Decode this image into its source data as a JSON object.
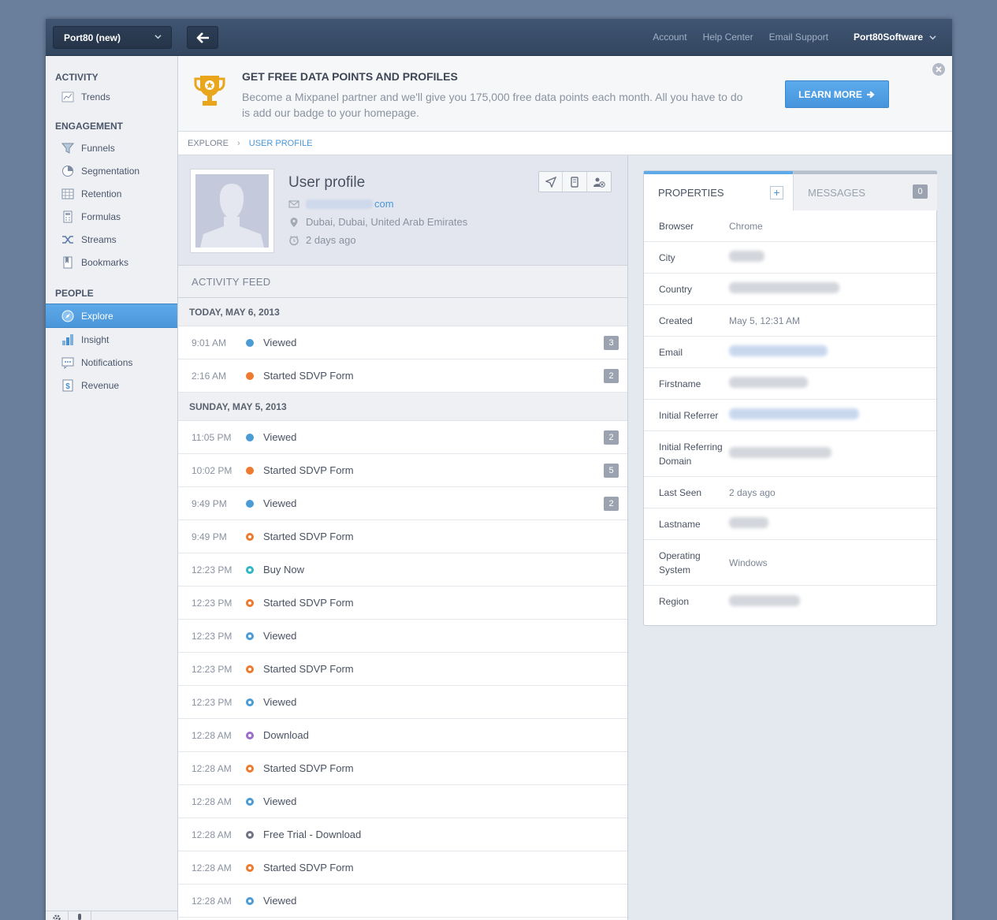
{
  "topbar": {
    "project": "Port80 (new)",
    "links": [
      "Account",
      "Help Center",
      "Email Support"
    ],
    "user": "Port80Software"
  },
  "sidebar": {
    "sections": [
      {
        "title": "ACTIVITY",
        "items": [
          {
            "label": "Trends",
            "icon": "trends-icon"
          }
        ]
      },
      {
        "title": "ENGAGEMENT",
        "items": [
          {
            "label": "Funnels",
            "icon": "funnel-icon"
          },
          {
            "label": "Segmentation",
            "icon": "pie-chart-icon"
          },
          {
            "label": "Retention",
            "icon": "retention-grid-icon"
          },
          {
            "label": "Formulas",
            "icon": "calculator-icon"
          },
          {
            "label": "Streams",
            "icon": "shuffle-icon"
          },
          {
            "label": "Bookmarks",
            "icon": "bookmark-icon"
          }
        ]
      },
      {
        "title": "PEOPLE",
        "items": [
          {
            "label": "Explore",
            "icon": "compass-icon",
            "active": true
          },
          {
            "label": "Insight",
            "icon": "bar-chart-icon"
          },
          {
            "label": "Notifications",
            "icon": "message-icon"
          },
          {
            "label": "Revenue",
            "icon": "dollar-icon"
          }
        ]
      }
    ]
  },
  "banner": {
    "title": "GET FREE DATA POINTS AND PROFILES",
    "text": "Become a Mixpanel partner and we'll give you 175,000 free data points each month. All you have to do is add our badge to your homepage.",
    "button": "LEARN MORE"
  },
  "breadcrumb": {
    "parent": "EXPLORE",
    "current": "USER PROFILE"
  },
  "profile": {
    "title": "User profile",
    "email_suffix": "com",
    "location": "Dubai, Dubai, United Arab Emirates",
    "last_seen": "2 days ago"
  },
  "feed": {
    "header": "ACTIVITY FEED",
    "days": [
      {
        "label": "TODAY, MAY 6, 2013",
        "events": [
          {
            "time": "9:01 AM",
            "name": "Viewed",
            "color": "#4b9bd6",
            "ring": false,
            "count": "3"
          },
          {
            "time": "2:16 AM",
            "name": "Started SDVP Form",
            "color": "#ee7a30",
            "ring": false,
            "count": "2"
          }
        ]
      },
      {
        "label": "SUNDAY, MAY 5, 2013",
        "events": [
          {
            "time": "11:05 PM",
            "name": "Viewed",
            "color": "#4b9bd6",
            "ring": false,
            "count": "2"
          },
          {
            "time": "10:02 PM",
            "name": "Started SDVP Form",
            "color": "#ee7a30",
            "ring": false,
            "count": "5"
          },
          {
            "time": "9:49 PM",
            "name": "Viewed",
            "color": "#4b9bd6",
            "ring": false,
            "count": "2"
          },
          {
            "time": "9:49 PM",
            "name": "Started SDVP Form",
            "color": "#ee7a30",
            "ring": true,
            "count": ""
          },
          {
            "time": "12:23 PM",
            "name": "Buy Now",
            "color": "#2fb8c4",
            "ring": true,
            "count": ""
          },
          {
            "time": "12:23 PM",
            "name": "Started SDVP Form",
            "color": "#ee7a30",
            "ring": true,
            "count": ""
          },
          {
            "time": "12:23 PM",
            "name": "Viewed",
            "color": "#4b9bd6",
            "ring": true,
            "count": ""
          },
          {
            "time": "12:23 PM",
            "name": "Started SDVP Form",
            "color": "#ee7a30",
            "ring": true,
            "count": ""
          },
          {
            "time": "12:23 PM",
            "name": "Viewed",
            "color": "#4b9bd6",
            "ring": true,
            "count": ""
          },
          {
            "time": "12:28 AM",
            "name": "Download",
            "color": "#9b6fc9",
            "ring": true,
            "count": ""
          },
          {
            "time": "12:28 AM",
            "name": "Started SDVP Form",
            "color": "#ee7a30",
            "ring": true,
            "count": ""
          },
          {
            "time": "12:28 AM",
            "name": "Viewed",
            "color": "#4b9bd6",
            "ring": true,
            "count": ""
          },
          {
            "time": "12:28 AM",
            "name": "Free Trial - Download",
            "color": "#6f7382",
            "ring": true,
            "count": ""
          },
          {
            "time": "12:28 AM",
            "name": "Started SDVP Form",
            "color": "#ee7a30",
            "ring": true,
            "count": ""
          },
          {
            "time": "12:28 AM",
            "name": "Viewed",
            "color": "#4b9bd6",
            "ring": true,
            "count": ""
          }
        ]
      }
    ]
  },
  "properties": {
    "tab_properties": "PROPERTIES",
    "tab_messages": "MESSAGES",
    "messages_count": "0",
    "rows": [
      {
        "key": "Browser",
        "value": "Chrome"
      },
      {
        "key": "City",
        "value": ""
      },
      {
        "key": "Country",
        "value": ""
      },
      {
        "key": "Created",
        "value": "May 5, 12:31 AM"
      },
      {
        "key": "Email",
        "value": ""
      },
      {
        "key": "Firstname",
        "value": ""
      },
      {
        "key": "Initial Referrer",
        "value": ""
      },
      {
        "key": "Initial Referring Domain",
        "value": ""
      },
      {
        "key": "Last Seen",
        "value": "2 days ago"
      },
      {
        "key": "Lastname",
        "value": ""
      },
      {
        "key": "Operating System",
        "value": "Windows"
      },
      {
        "key": "Region",
        "value": ""
      }
    ]
  }
}
